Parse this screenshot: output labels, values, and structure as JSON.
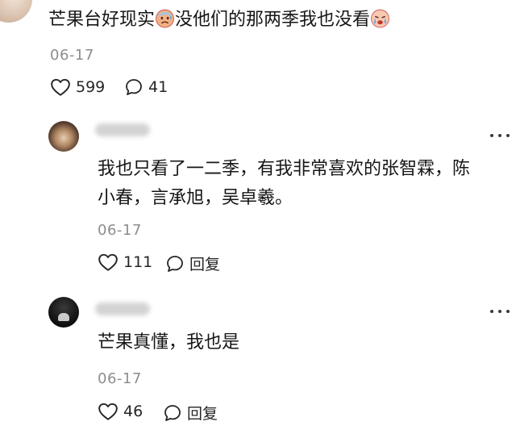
{
  "comment": {
    "text_part1": "芒果台好现实",
    "emoji1": "cold-sweat-face-emoji",
    "text_part2": "没他们的那两季我也没看",
    "emoji2": "crying-face-emoji",
    "date": "06-17",
    "likes": "599",
    "replies": "41"
  },
  "reply1": {
    "line1": "我也只看了一二季，有我非常喜欢的张智霖，陈",
    "line2": "小春，言承旭，吴卓羲。",
    "date": "06-17",
    "likes": "111",
    "reply_label": "回复"
  },
  "reply2": {
    "text": "芒果真懂，我也是",
    "date": "06-17",
    "likes": "46",
    "reply_label": "回复"
  },
  "colors": {
    "text": "#161616",
    "date": "#8d8d8d",
    "icon": "#262626"
  }
}
